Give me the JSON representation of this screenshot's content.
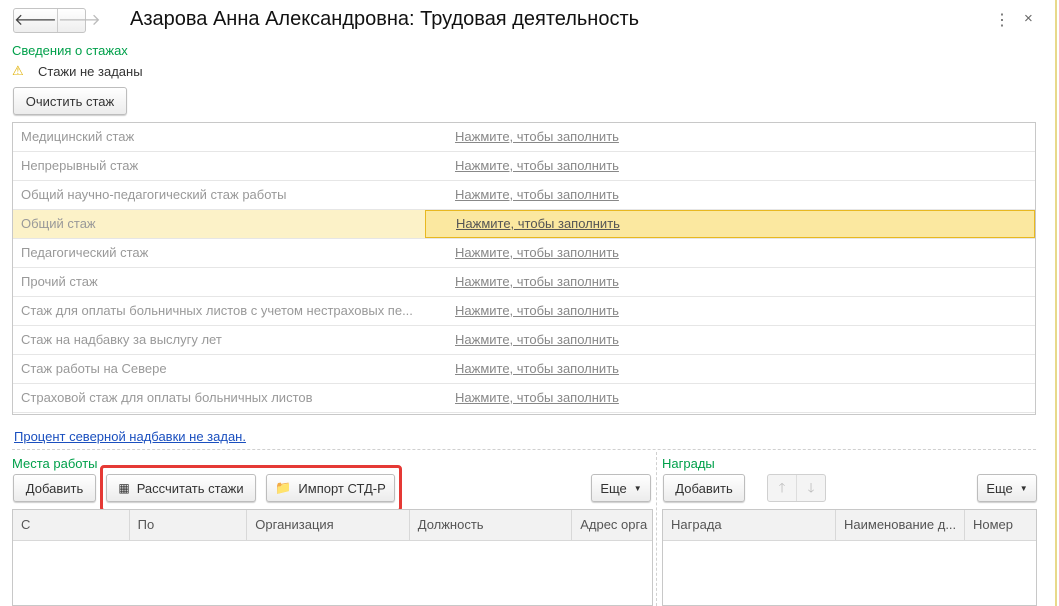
{
  "title": "Азарова Анна Александровна: Трудовая деятельность",
  "section_title": "Сведения о стажах",
  "warning": "Стажи не заданы",
  "clear_button": "Очистить стаж",
  "fill_link": "Нажмите, чтобы заполнить",
  "experience_rows": [
    "Медицинский стаж",
    "Непрерывный стаж",
    "Общий научно-педагогический стаж работы",
    "Общий стаж",
    "Педагогический стаж",
    "Прочий стаж",
    "Стаж для оплаты больничных листов с учетом нестраховых пе...",
    "Стаж на надбавку за выслугу лет",
    "Стаж работы на Севере",
    "Страховой стаж для оплаты больничных листов"
  ],
  "north_link": "Процент северной надбавки не задан.",
  "workplaces": {
    "title": "Места работы",
    "add": "Добавить",
    "calc": "Рассчитать стажи",
    "import": "Импорт СТД-Р",
    "more": "Еще",
    "columns": [
      "С",
      "По",
      "Организация",
      "Должность",
      "Адрес орга"
    ]
  },
  "awards": {
    "title": "Награды",
    "add": "Добавить",
    "more": "Еще",
    "columns": [
      "Награда",
      "Наименование д...",
      "Номер"
    ]
  },
  "colors": {
    "accent_green": "#00a04a",
    "highlight": "#e53935"
  }
}
